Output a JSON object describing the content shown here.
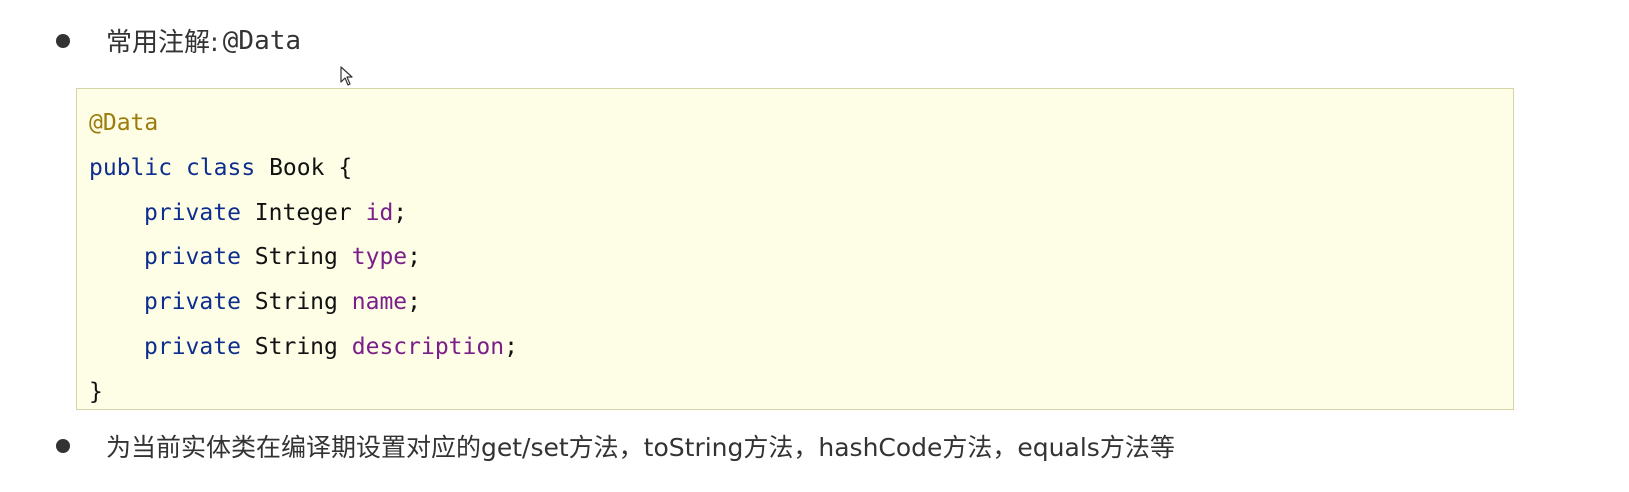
{
  "bullet1": {
    "label": "常用注解:",
    "code": "@Data"
  },
  "code": {
    "annotation": "@Data",
    "line_class": {
      "kw_public": "public",
      "kw_class": "class",
      "class_name": "Book",
      "brace_open": "{"
    },
    "fields": [
      {
        "kw": "private",
        "type": "Integer",
        "name": "id",
        "end": ";"
      },
      {
        "kw": "private",
        "type": "String",
        "name": "type",
        "end": ";"
      },
      {
        "kw": "private",
        "type": "String",
        "name": "name",
        "end": ";"
      },
      {
        "kw": "private",
        "type": "String",
        "name": "description",
        "end": ";"
      }
    ],
    "brace_close": "}"
  },
  "bullet2": {
    "text": "为当前实体类在编译期设置对应的get/set方法，toString方法，hashCode方法，equals方法等"
  },
  "colors": {
    "code_background": "#fefde6",
    "annotation": "#9b7c0a",
    "keyword": "#0e2e8f",
    "field": "#7a1f8a"
  }
}
